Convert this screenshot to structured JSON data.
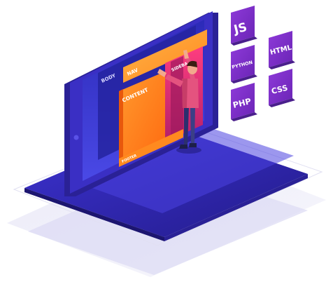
{
  "screen": {
    "body_label": "BODY",
    "nav_label": "NAV",
    "content_label": "CONTENT",
    "sidebar_label": "SIDEBAR",
    "footer_label": "FOOTER"
  },
  "badges": {
    "js": "JS",
    "html": "HTML",
    "python": "PYTHON",
    "css": "CSS",
    "php": "PHP"
  },
  "colors": {
    "device_frame": "#3a2fc4",
    "device_frame_dark": "#2a2196",
    "screen": "#3b36d8",
    "base": "#2b239e",
    "nav_block": "#ff9a2e",
    "content_block": "#ff7a1a",
    "sidebar_block": "#e0306f",
    "badge": "#7a2fc8",
    "badge_side": "#4a1f8c"
  },
  "icons": {
    "person": "developer-person-icon"
  }
}
